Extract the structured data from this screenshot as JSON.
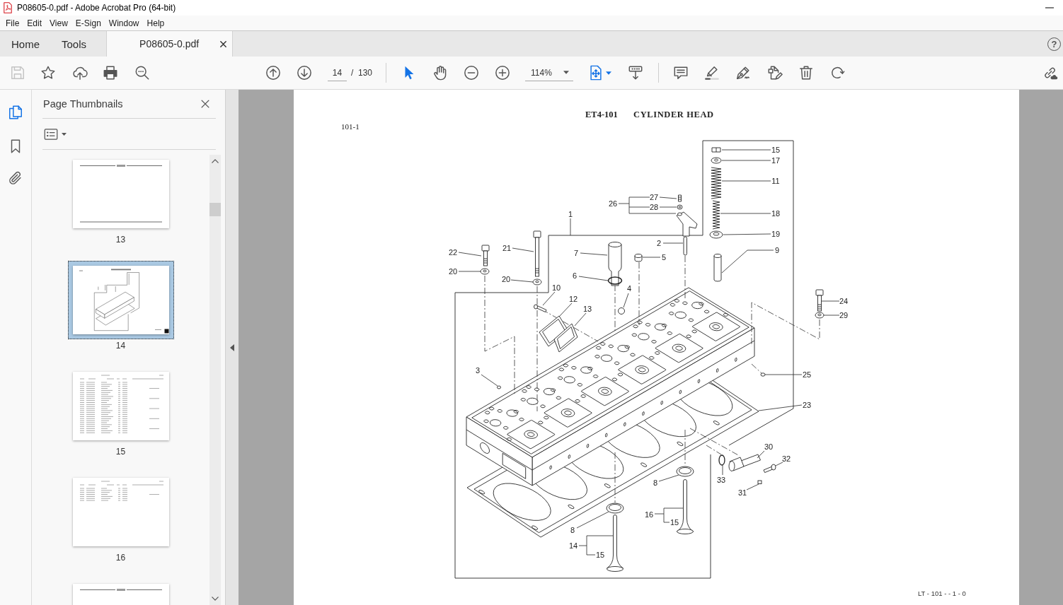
{
  "window": {
    "title": "P08605-0.pdf - Adobe Acrobat Pro (64-bit)"
  },
  "menu": [
    "File",
    "Edit",
    "View",
    "E-Sign",
    "Window",
    "Help"
  ],
  "tabs": [
    {
      "label": "Home",
      "selected": false,
      "closable": false
    },
    {
      "label": "Tools",
      "selected": false,
      "closable": false
    },
    {
      "label": "P08605-0.pdf",
      "selected": true,
      "closable": true
    }
  ],
  "help": "?",
  "toolbar": {
    "file_tools": [
      {
        "kind": "save",
        "disabled": true
      },
      {
        "kind": "star",
        "disabled": false
      },
      {
        "kind": "upload",
        "disabled": false
      },
      {
        "kind": "print",
        "disabled": false
      },
      {
        "kind": "find",
        "disabled": false
      }
    ],
    "page": "14",
    "page_separator": "/",
    "page_count": "130",
    "mode_tools": [
      {
        "kind": "select",
        "selected": true
      },
      {
        "kind": "hand",
        "selected": false
      }
    ],
    "zoom": "114%"
  },
  "navigation_tools": [
    {
      "kind": "pages",
      "selected": true
    },
    {
      "kind": "bookmarks",
      "selected": false
    },
    {
      "kind": "attachments",
      "selected": false
    }
  ],
  "thumbnails_panel": {
    "title": "Page Thumbnails",
    "thumbnails": [
      {
        "label": "13",
        "kind": "memo",
        "selected": false
      },
      {
        "label": "14",
        "kind": "diagram",
        "selected": true
      },
      {
        "label": "15",
        "kind": "table",
        "selected": false
      },
      {
        "label": "16",
        "kind": "short_table",
        "selected": false
      },
      {
        "kind": "memo",
        "selected": false
      }
    ]
  },
  "page": {
    "section": "101-1",
    "code": "ET4-101",
    "title": "CYLINDER HEAD",
    "callouts": [
      "15",
      "17",
      "11",
      "27",
      "26",
      "28",
      "1",
      "18",
      "19",
      "2",
      "22",
      "21",
      "7",
      "5",
      "9",
      "20",
      "20",
      "6",
      "10",
      "4",
      "12",
      "24",
      "13",
      "29",
      "3",
      "25",
      "23",
      "30",
      "32",
      "8",
      "33",
      "31",
      "16",
      "15",
      "8",
      "14",
      "15"
    ],
    "footer": "LT - 101 - - 1 - 0"
  }
}
